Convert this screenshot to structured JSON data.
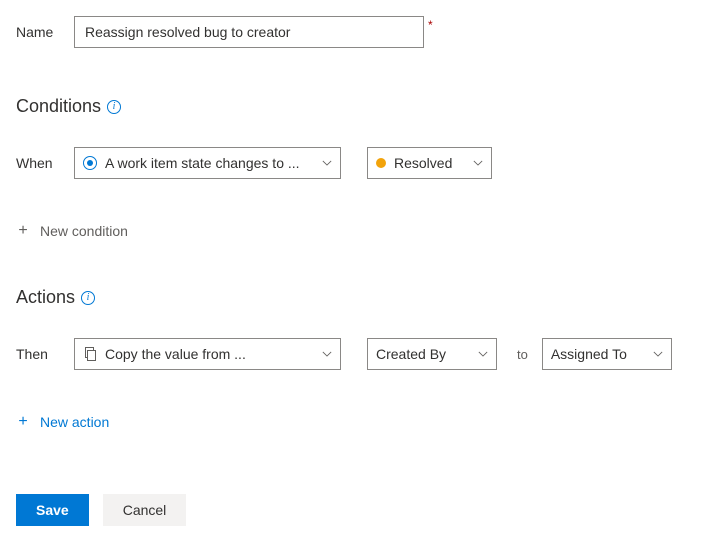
{
  "name": {
    "label": "Name",
    "value": "Reassign resolved bug to creator"
  },
  "conditions": {
    "heading": "Conditions",
    "when_label": "When",
    "trigger_text": "A work item state changes to ...",
    "state_value": "Resolved",
    "state_color": "#f2a30b",
    "add_label": "New condition"
  },
  "actions": {
    "heading": "Actions",
    "then_label": "Then",
    "action_text": "Copy the value from ...",
    "from_field": "Created By",
    "to_label": "to",
    "to_field": "Assigned To",
    "add_label": "New action"
  },
  "footer": {
    "save": "Save",
    "cancel": "Cancel"
  }
}
